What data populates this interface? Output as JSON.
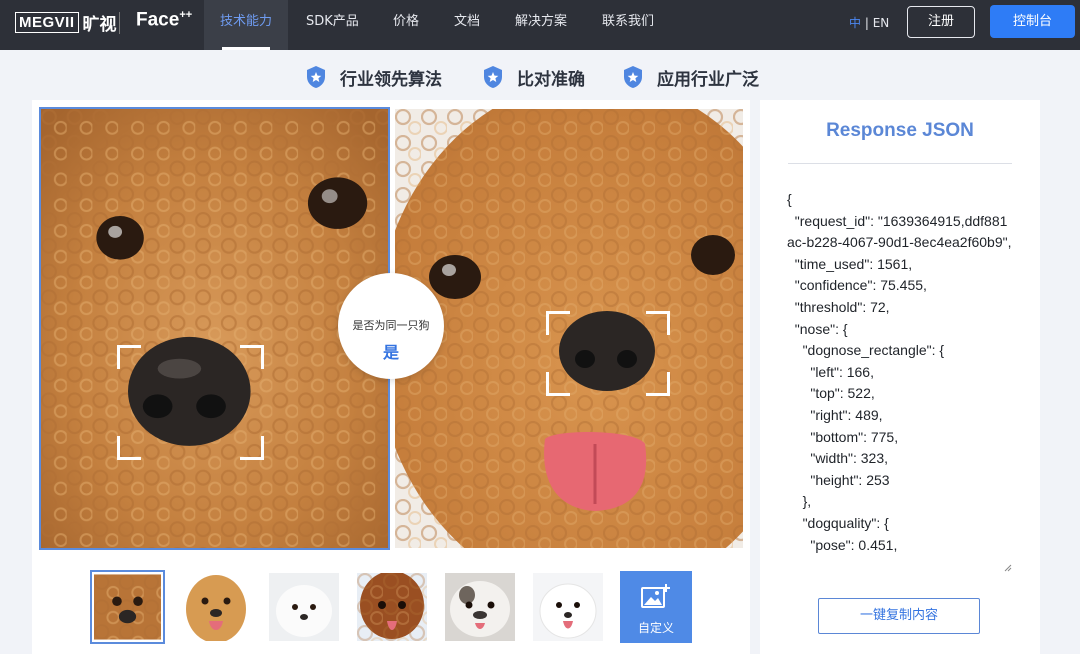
{
  "nav": {
    "logo_box": "MEGVII",
    "logo_cn": "旷视",
    "logo_face": "Face",
    "logo_face_sup": "++",
    "items": [
      {
        "label": "技术能力",
        "active": true
      },
      {
        "label": "SDK产品"
      },
      {
        "label": "价格"
      },
      {
        "label": "文档"
      },
      {
        "label": "解决方案"
      },
      {
        "label": "联系我们"
      }
    ],
    "lang_cn": "中",
    "lang_sep": "|",
    "lang_en": "EN",
    "register": "注册",
    "console": "控制台"
  },
  "features": [
    "行业领先算法",
    "比对准确",
    "应用行业广泛"
  ],
  "compare": {
    "question": "是否为同一只狗",
    "answer": "是"
  },
  "thumbnails": [
    "poodle",
    "golden-retriever",
    "white-spitz",
    "red-poodle",
    "bulldog",
    "samoyed"
  ],
  "custom_label": "自定义",
  "json_panel": {
    "title": "Response JSON",
    "content": "{\n  \"request_id\": \"1639364915,ddf881ac-b228-4067-90d1-8ec4ea2f60b9\",\n  \"time_used\": 1561,\n  \"confidence\": 75.455,\n  \"threshold\": 72,\n  \"nose\": {\n    \"dognose_rectangle\": {\n      \"left\": 166,\n      \"top\": 522,\n      \"right\": 489,\n      \"bottom\": 775,\n      \"width\": 323,\n      \"height\": 253\n    },\n    \"dogquality\": {\n      \"pose\": 0.451,",
    "copy_button": "一键复制内容"
  },
  "colors": {
    "nav_bg": "#2d3038",
    "accent": "#2e7cf6",
    "title_blue": "#5b87d6",
    "fur": "#c98a4a"
  }
}
